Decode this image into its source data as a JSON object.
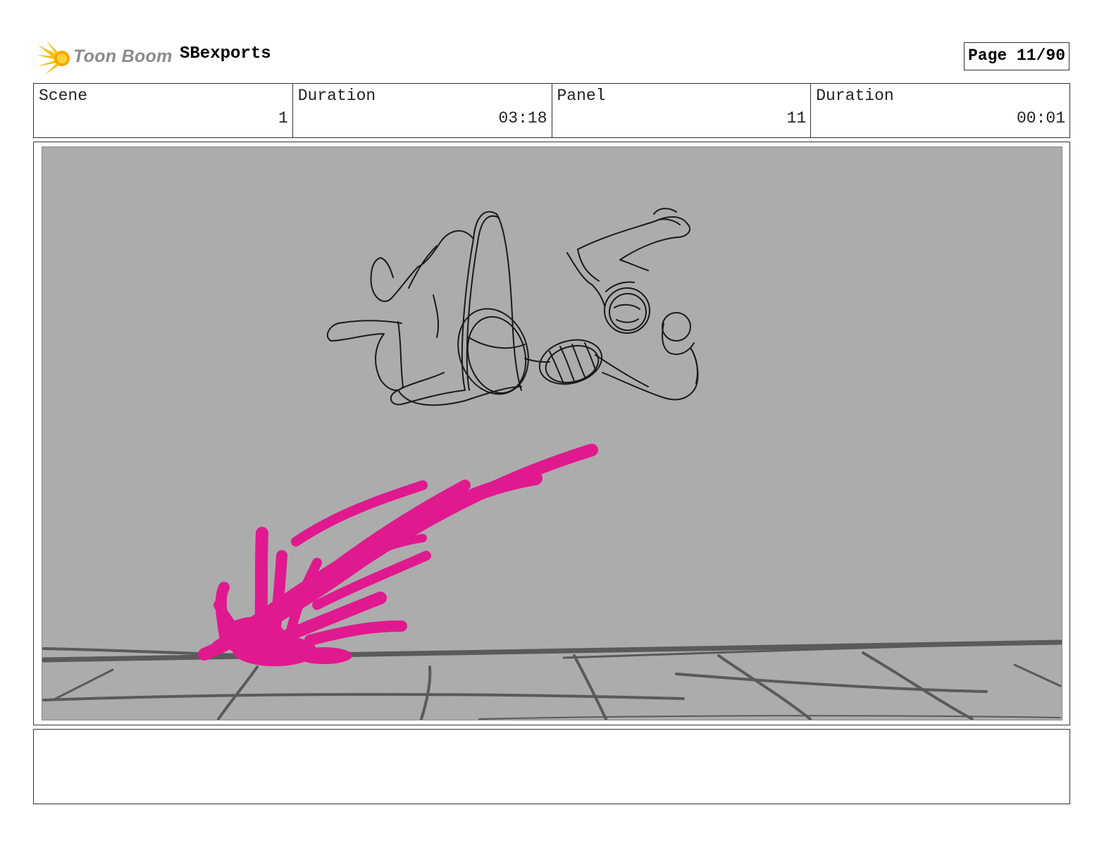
{
  "header": {
    "logo_text": "Toon Boom",
    "project_name": "SBexports",
    "page_label": "Page 11/90"
  },
  "info": {
    "scene_label": "Scene",
    "scene_value": "1",
    "scene_duration_label": "Duration",
    "scene_duration_value": "03:18",
    "panel_label": "Panel",
    "panel_value": "11",
    "panel_duration_label": "Duration",
    "panel_duration_value": "00:01"
  },
  "panel_image": {
    "background_color": "#acacac",
    "effect_color": "#e0198f",
    "sketch_color": "#1a1a1a",
    "floor_color": "#5a5a5a"
  },
  "notes": {
    "text": ""
  }
}
